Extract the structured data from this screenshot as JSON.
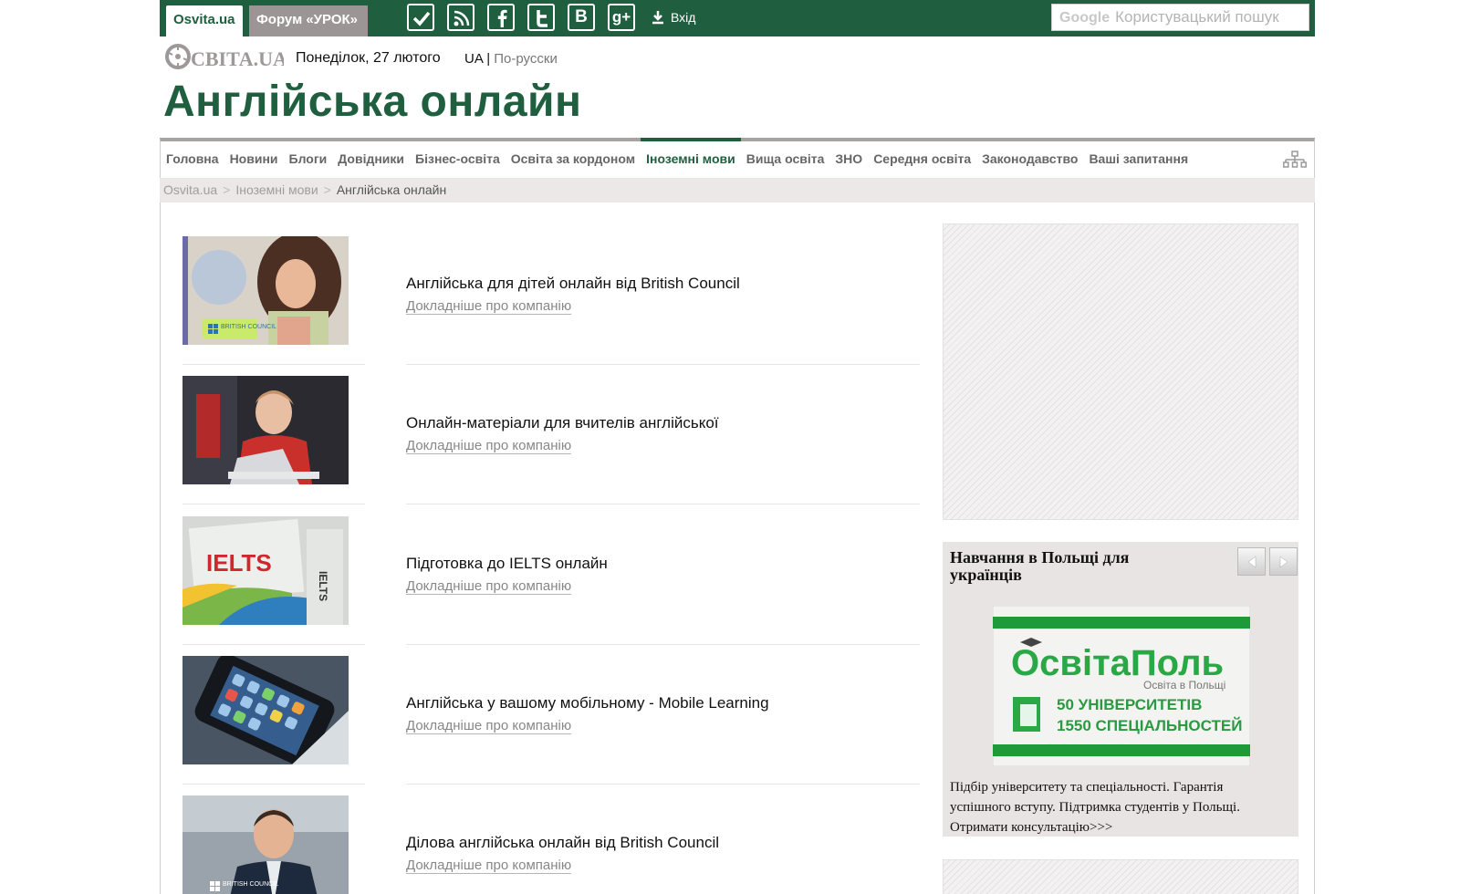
{
  "topbar": {
    "tab_osvita": "Osvita.ua",
    "tab_forum": "Форум «УРОК»",
    "social_icons": [
      "check-icon",
      "rss-icon",
      "facebook-icon",
      "twitter-icon",
      "vkontakte-icon",
      "google-plus-icon"
    ],
    "vk_letter": "B",
    "gplus_letter": "g+",
    "login_label": "Вхід",
    "search_brand": "Google",
    "search_placeholder": "Користувацький пошук"
  },
  "header": {
    "logo_text": "ОСВІТА.UA",
    "date": "Понеділок, 27 лютого",
    "lang_current": "UA",
    "lang_divider": "|",
    "lang_other": "По-русски",
    "page_title": "Англійська онлайн"
  },
  "nav": {
    "items": [
      "Головна",
      "Новини",
      "Блоги",
      "Довідники",
      "Бізнес-освіта",
      "Освіта за кордоном",
      "Іноземні мови",
      "Вища освіта",
      "ЗНО",
      "Середня освіта",
      "Законодавство",
      "Ваші запитання"
    ],
    "active": "Іноземні мови"
  },
  "breadcrumb": {
    "items": [
      "Osvita.ua",
      "Іноземні мови"
    ],
    "separator": ">",
    "current": "Англійська онлайн"
  },
  "list": {
    "items": [
      {
        "title": "Англійська для дітей онлайн від British Council",
        "link": "Докладніше про компанію",
        "thumb_caption": "BRITISH COUNCIL"
      },
      {
        "title": "Онлайн-матеріали для вчителів англійської",
        "link": "Докладніше про компанію"
      },
      {
        "title": "Підготовка до IELTS онлайн",
        "link": "Докладніше про компанію",
        "thumb_caption": "IELTS"
      },
      {
        "title": "Англійська у вашому мобільному - Mobile Learning",
        "link": "Докладніше про компанію"
      },
      {
        "title": "Ділова англійська онлайн від British Council",
        "link": "Докладніше про компанію",
        "thumb_caption": "BRITISH COUNCIL"
      }
    ]
  },
  "sidebar": {
    "promo_title": "Навчання в Польщі для українців",
    "banner_brand_main": "ОсвітаПоль",
    "banner_brand_sub": "Освіта в Польщі",
    "banner_line1": "50 УНІВЕРСИТЕТІВ",
    "banner_line2": "1550 СПЕЦІАЛЬНОСТЕЙ",
    "promo_text": "Підбір університету та спеціальності. Гарантія успішного вступу. Підтримка студентів у Польщі. Отримати консультацію>>>"
  },
  "colors": {
    "brand_green": "#1f5f3f",
    "forum_tab": "#9b9595",
    "breadcrumb_bg": "#ece8e7",
    "link_gray": "#888888"
  }
}
